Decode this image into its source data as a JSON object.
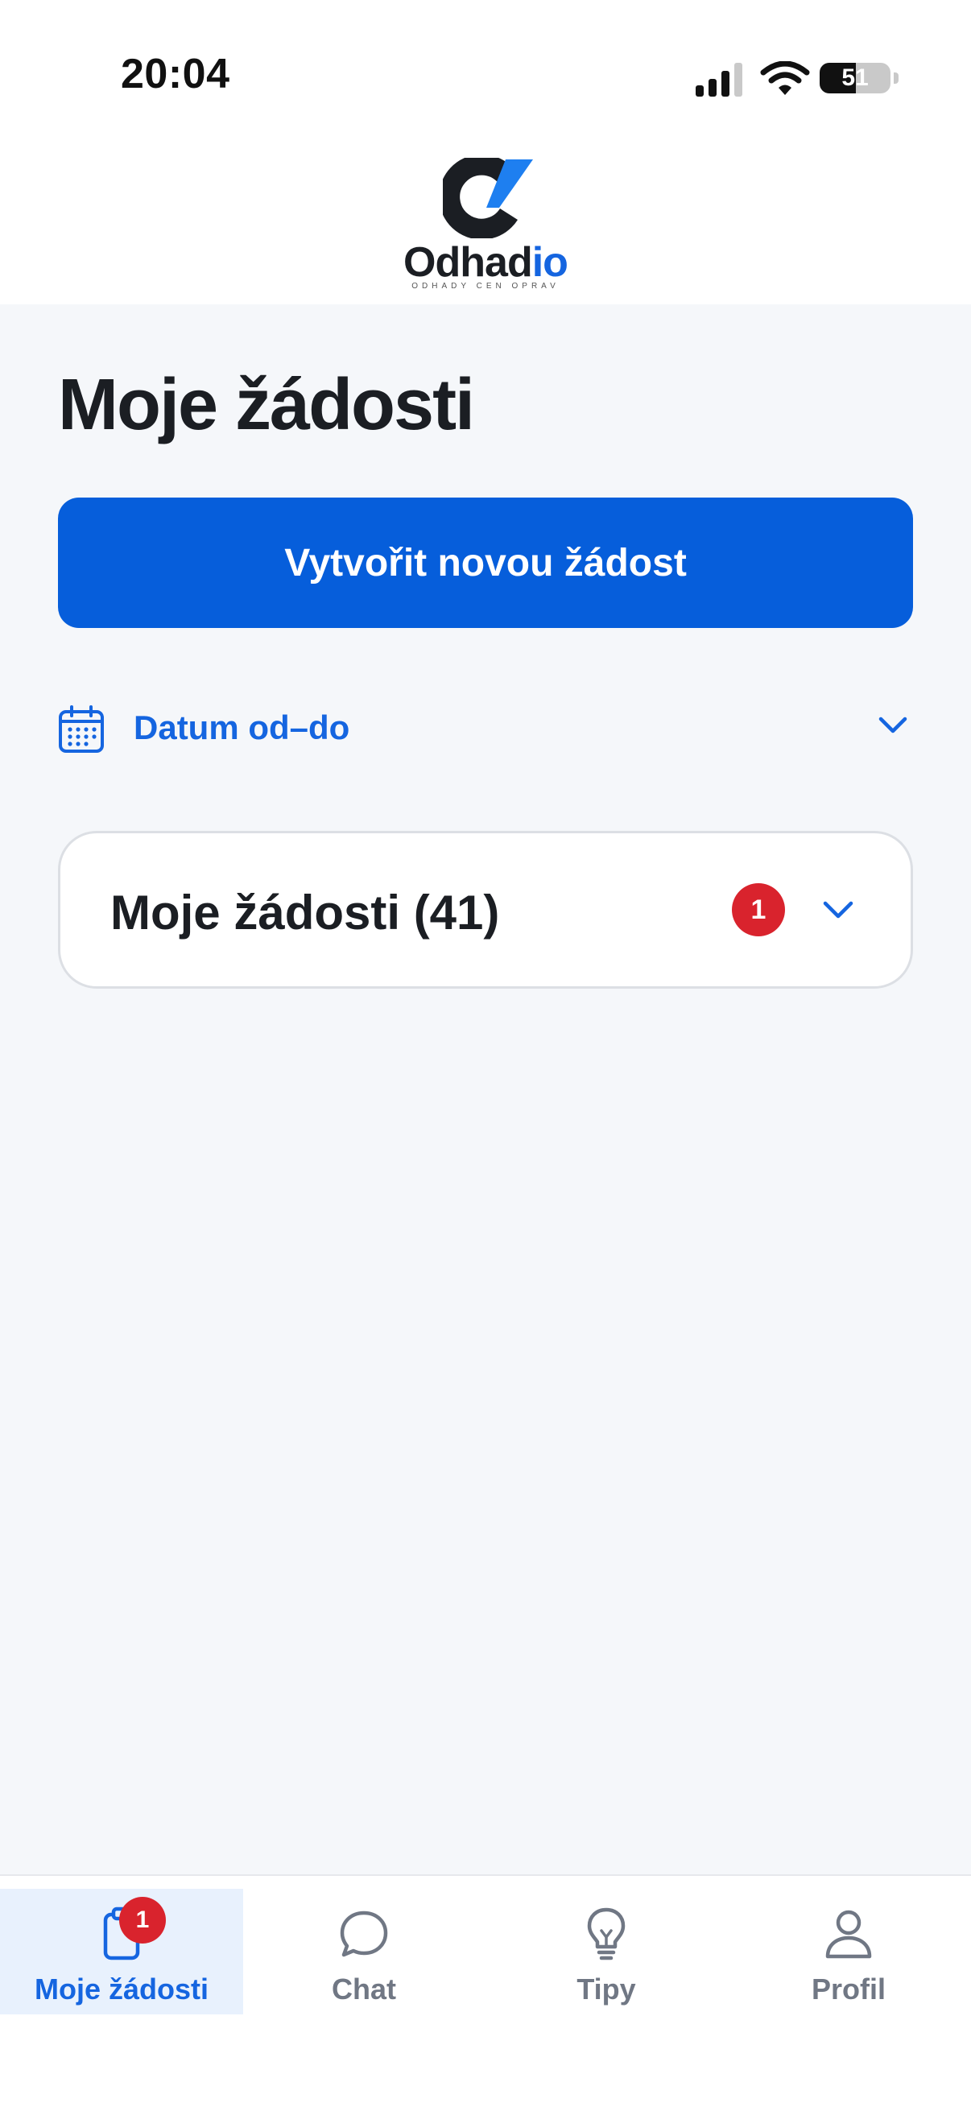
{
  "status_bar": {
    "time": "20:04",
    "battery_level": "51",
    "battery_fraction": 0.51
  },
  "brand": {
    "wordmark_main": "Odhad",
    "wordmark_accent": "io",
    "tagline": "ODHADY CEN OPRAV",
    "accent_color": "#1565e0"
  },
  "page": {
    "title": "Moje žádosti"
  },
  "primary_action": {
    "label": "Vytvořit novou žádost",
    "color": "#065edb"
  },
  "date_filter": {
    "label": "Datum od–do",
    "icon": "calendar-icon",
    "chevron": "chevron-down-icon"
  },
  "requests_section": {
    "title": "Moje žádosti (41)",
    "badge_count": "1",
    "chevron": "chevron-down-icon"
  },
  "tab_bar": {
    "items": [
      {
        "label": "Moje žádosti",
        "icon": "clipboard-icon",
        "badge": "1",
        "active": true
      },
      {
        "label": "Chat",
        "icon": "chat-bubble-icon",
        "active": false
      },
      {
        "label": "Tipy",
        "icon": "lightbulb-icon",
        "active": false
      },
      {
        "label": "Profil",
        "icon": "user-icon",
        "active": false
      }
    ]
  },
  "colors": {
    "badge_red": "#d9232d",
    "background": "#f5f7fa",
    "inactive_tab": "#707784"
  }
}
